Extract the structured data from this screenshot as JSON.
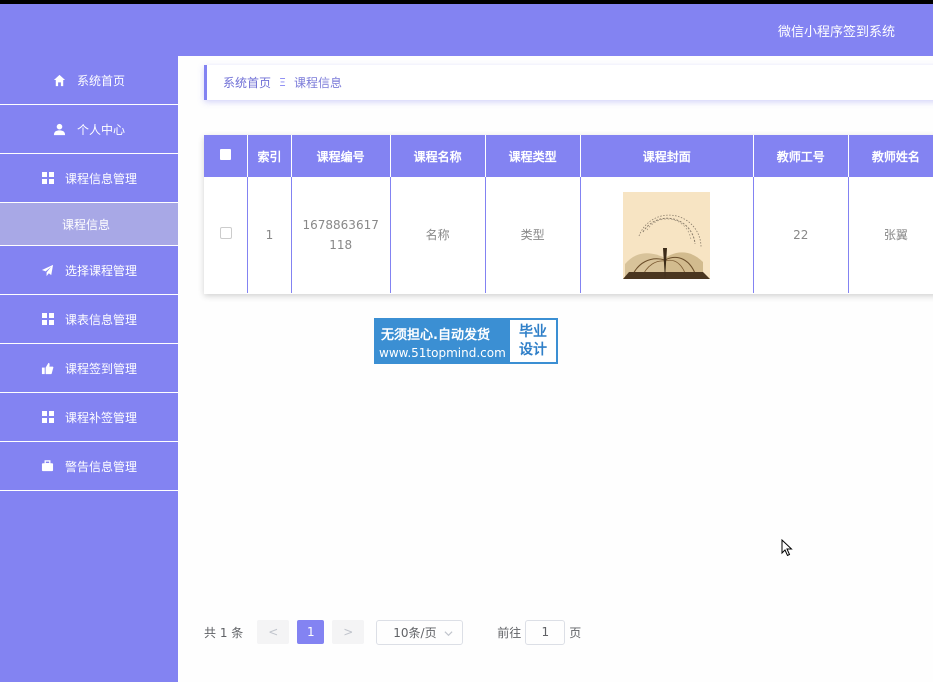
{
  "header": {
    "title": "微信小程序签到系统"
  },
  "sidebar": {
    "items": [
      {
        "label": "系统首页",
        "icon": "home-icon"
      },
      {
        "label": "个人中心",
        "icon": "user-icon"
      },
      {
        "label": "课程信息管理",
        "icon": "grid-icon"
      },
      {
        "label": "课程信息",
        "icon": ""
      },
      {
        "label": "选择课程管理",
        "icon": "send-icon"
      },
      {
        "label": "课表信息管理",
        "icon": "grid-icon"
      },
      {
        "label": "课程签到管理",
        "icon": "thumb-icon"
      },
      {
        "label": "课程补签管理",
        "icon": "grid-icon"
      },
      {
        "label": "警告信息管理",
        "icon": "briefcase-icon"
      }
    ]
  },
  "breadcrumb": {
    "home": "系统首页",
    "separator": "Ξ",
    "current": "课程信息"
  },
  "table": {
    "headers": [
      "索引",
      "课程编号",
      "课程名称",
      "课程类型",
      "课程封面",
      "教师工号",
      "教师姓名"
    ],
    "rows": [
      {
        "index": "1",
        "code": "1678863617118",
        "name": "名称",
        "type": "类型",
        "teacher_id": "22",
        "teacher_name": "张翼"
      }
    ]
  },
  "watermark": {
    "line1": "无须担心.自动发货",
    "line2": "www.51topmind.com",
    "badge1": "毕业",
    "badge2": "设计"
  },
  "pagination": {
    "total": "共 1 条",
    "prev": "<",
    "current_page": "1",
    "next": ">",
    "page_size": "10条/页",
    "goto_label": "前往",
    "goto_value": "1",
    "goto_unit": "页"
  },
  "colors": {
    "accent": "#8383f2",
    "sub_menu": "#a8a8e6"
  }
}
